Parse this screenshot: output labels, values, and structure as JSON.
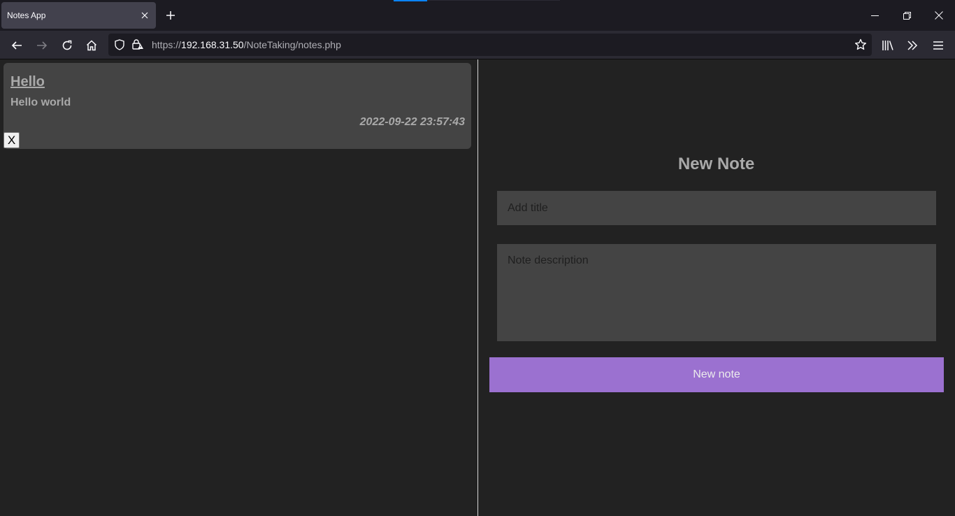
{
  "browser": {
    "tab_title": "Notes App",
    "url_prefix": "https://",
    "url_host": "192.168.31.50",
    "url_path": "/NoteTaking/notes.php",
    "accent_color": "#0a84ff"
  },
  "notes": [
    {
      "title": "Hello",
      "description": "Hello world",
      "date": "2022-09-22 23:57:43",
      "delete_label": "X"
    }
  ],
  "form": {
    "heading": "New Note",
    "title_placeholder": "Add title",
    "description_placeholder": "Note description",
    "submit_label": "New note",
    "submit_color": "#9b71d0"
  }
}
